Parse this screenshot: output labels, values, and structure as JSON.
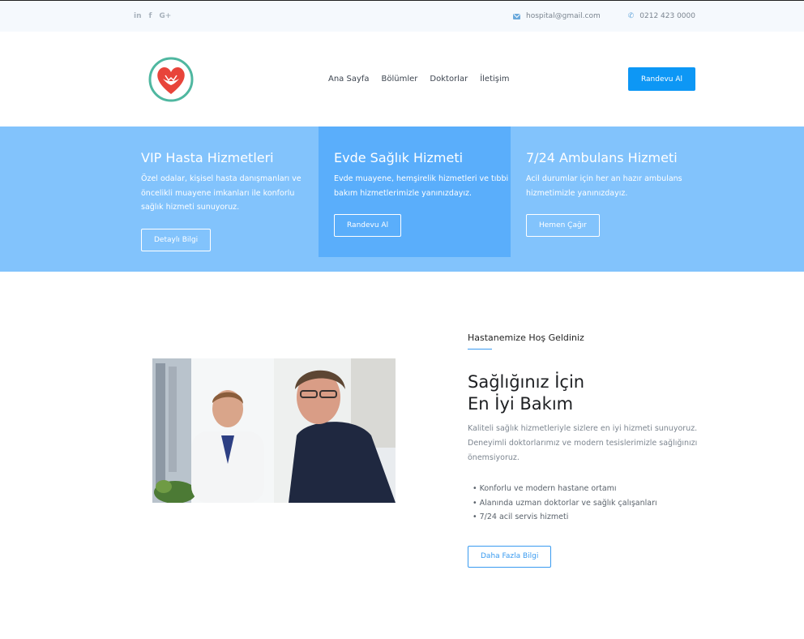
{
  "topbar": {
    "social": [
      "in",
      "f",
      "G+"
    ],
    "email": "hospital@gmail.com",
    "phone": "0212 423 0000"
  },
  "header": {
    "nav": [
      "Ana Sayfa",
      "Bölümler",
      "Doktorlar",
      "İletişim"
    ],
    "cta": "Randevu Al"
  },
  "services": [
    {
      "title": "VIP Hasta Hizmetleri",
      "text": "Özel odalar, kişisel hasta danışmanları ve öncelikli muayene imkanları ile konforlu sağlık hizmeti sunuyoruz.",
      "button": "Detaylı Bilgi"
    },
    {
      "title": "Evde Sağlık Hizmeti",
      "text": "Evde muayene, hemşirelik hizmetleri ve tıbbi bakım hizmetlerimizle yanınızdayız.",
      "button": "Randevu Al"
    },
    {
      "title": "7/24 Ambulans Hizmeti",
      "text": "Acil durumlar için her an hazır ambulans hizmetimizle yanınızdayız.",
      "button": "Hemen Çağır"
    }
  ],
  "welcome": {
    "kicker": "Hastanemize Hoş Geldiniz",
    "title_line1": "Sağlığınız İçin",
    "title_line2": "En İyi Bakım",
    "description": "Kaliteli sağlık hizmetleriyle sizlere en iyi hizmeti sunuyoruz. Deneyimli doktorlarımız ve modern tesislerimizle sağlığınızı önemsiyoruz.",
    "bullets": [
      "Konforlu ve modern hastane ortamı",
      "Alanında uzman doktorlar ve sağlık çalışanları",
      "7/24 acil servis hizmeti"
    ],
    "button": "Daha Fazla Bilgi"
  },
  "colors": {
    "primary": "#0d97f5",
    "services_bg": "#82c3fc",
    "services_active": "#5aaefb"
  },
  "icons": [
    "linkedin-icon",
    "facebook-icon",
    "google-plus-icon",
    "mail-icon",
    "phone-icon",
    "heart-hands-logo"
  ]
}
